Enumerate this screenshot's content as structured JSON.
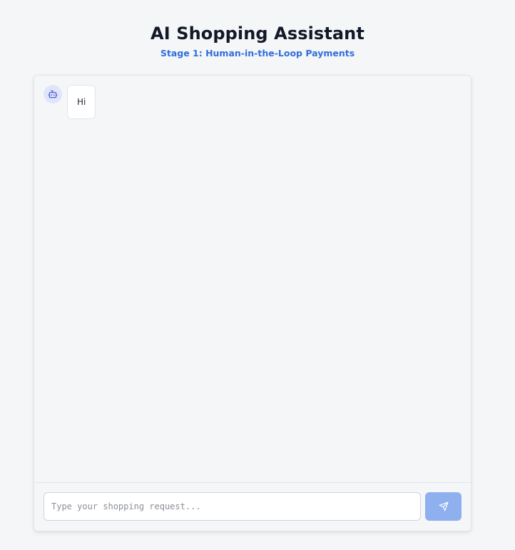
{
  "header": {
    "title": "AI Shopping Assistant",
    "subtitle": "Stage 1: Human-in-the-Loop Payments"
  },
  "messages": [
    {
      "sender": "assistant",
      "avatar_icon": "robot-icon",
      "text": "Hi"
    }
  ],
  "composer": {
    "value": "",
    "placeholder": "Type your shopping request...",
    "send_icon": "send-icon"
  },
  "colors": {
    "background": "#f5f6f8",
    "subtitle_accent": "#2f6fdc",
    "avatar_bg": "#dfe6fb",
    "avatar_icon": "#4b55c9",
    "send_button": "#8fb0ef"
  }
}
